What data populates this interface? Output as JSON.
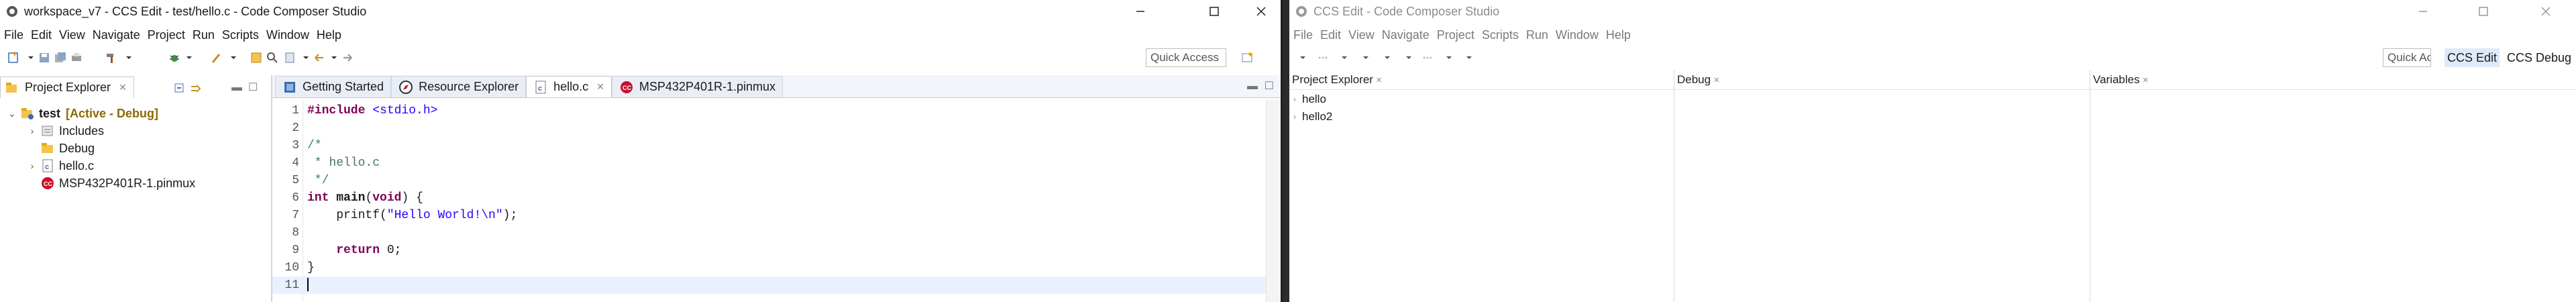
{
  "left_window": {
    "title": "workspace_v7 - CCS Edit - test/hello.c - Code Composer Studio",
    "menu": [
      "File",
      "Edit",
      "View",
      "Navigate",
      "Project",
      "Run",
      "Scripts",
      "Window",
      "Help"
    ],
    "quick_access": "Quick Access",
    "project_explorer": {
      "tab_label": "Project Explorer",
      "tree": [
        {
          "label": "test",
          "suffix": "[Active - Debug]",
          "icon": "project-folder-icon",
          "expanded": true,
          "level": 0
        },
        {
          "label": "Includes",
          "icon": "includes-icon",
          "expanded": false,
          "level": 1
        },
        {
          "label": "Debug",
          "icon": "folder-icon",
          "level": 1
        },
        {
          "label": "hello.c",
          "icon": "c-file-icon",
          "expanded": false,
          "level": 1
        },
        {
          "label": "MSP432P401R-1.pinmux",
          "icon": "pinmux-icon",
          "level": 1
        }
      ]
    },
    "editor": {
      "tabs": [
        {
          "label": "Getting Started",
          "icon": "ccs-icon",
          "active": false
        },
        {
          "label": "Resource Explorer",
          "icon": "compass-icon",
          "active": false
        },
        {
          "label": "hello.c",
          "icon": "c-file-icon",
          "active": true
        },
        {
          "label": "MSP432P401R-1.pinmux",
          "icon": "pinmux-icon",
          "active": false
        }
      ],
      "lines": [
        {
          "n": "1",
          "parts": [
            [
              "pp",
              "#include "
            ],
            [
              "st",
              "<stdio.h>"
            ]
          ]
        },
        {
          "n": "2",
          "parts": []
        },
        {
          "n": "3",
          "parts": [
            [
              "cm",
              "/*"
            ]
          ]
        },
        {
          "n": "4",
          "parts": [
            [
              "cm",
              " * hello.c"
            ]
          ]
        },
        {
          "n": "5",
          "parts": [
            [
              "cm",
              " */"
            ]
          ]
        },
        {
          "n": "6",
          "parts": [
            [
              "kw",
              "int"
            ],
            [
              "",
              " "
            ],
            [
              "b",
              "main"
            ],
            [
              "",
              "("
            ],
            [
              "kw",
              "void"
            ],
            [
              "",
              ") {"
            ]
          ]
        },
        {
          "n": "7",
          "parts": [
            [
              "",
              "    printf("
            ],
            [
              "st",
              "\"Hello World!\\n\""
            ],
            [
              "",
              ");"
            ]
          ]
        },
        {
          "n": "8",
          "parts": []
        },
        {
          "n": "9",
          "parts": [
            [
              "",
              "    "
            ],
            [
              "kw",
              "return"
            ],
            [
              "",
              " 0;"
            ]
          ]
        },
        {
          "n": "10",
          "parts": [
            [
              "",
              "}"
            ]
          ]
        },
        {
          "n": "11",
          "parts": [
            [
              "",
              ""
            ]
          ]
        }
      ]
    }
  },
  "right_window": {
    "title": "CCS Edit - Code Composer Studio",
    "menu": [
      "File",
      "Edit",
      "View",
      "Navigate",
      "Project",
      "Scripts",
      "Run",
      "Window",
      "Help"
    ],
    "quick_access": "Quick Ac",
    "perspectives": [
      "CCS Edit",
      "CCS Debug"
    ],
    "panes": [
      {
        "label": "Project Explorer",
        "items": [
          "hello",
          "hello2"
        ]
      },
      {
        "label": "Debug",
        "items": []
      },
      {
        "label": "Variables",
        "items": []
      }
    ]
  }
}
